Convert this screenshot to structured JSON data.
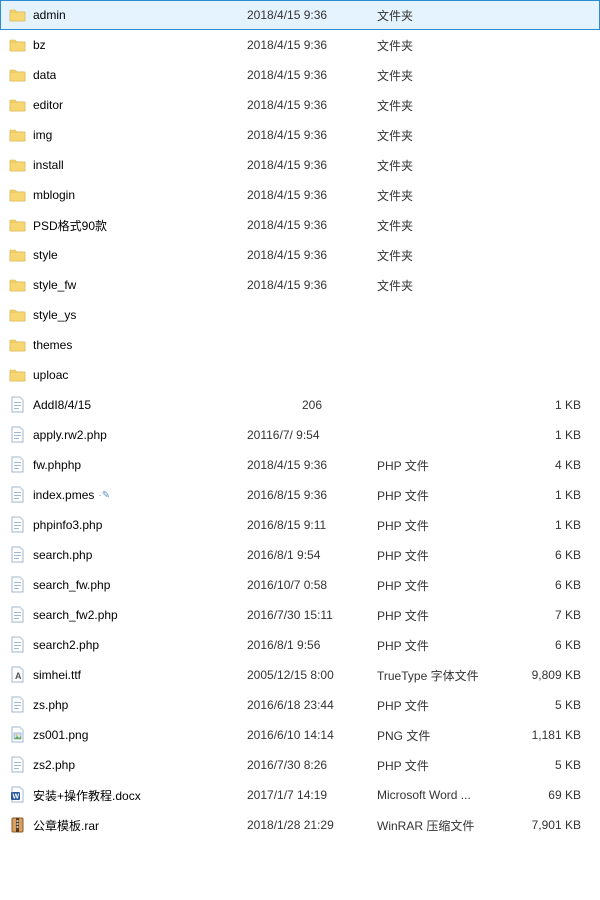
{
  "files": [
    {
      "name": "admin",
      "date": "2018/4/15 9:36",
      "type": "文件夹",
      "size": "",
      "icon": "folder",
      "selected": true
    },
    {
      "name": "bz",
      "date": "2018/4/15 9:36",
      "type": "文件夹",
      "size": "",
      "icon": "folder"
    },
    {
      "name": "data",
      "date": "2018/4/15 9:36",
      "type": "文件夹",
      "size": "",
      "icon": "folder"
    },
    {
      "name": "editor",
      "date": "2018/4/15 9:36",
      "type": "文件夹",
      "size": "",
      "icon": "folder"
    },
    {
      "name": "img",
      "date": "2018/4/15 9:36",
      "type": "文件夹",
      "size": "",
      "icon": "folder"
    },
    {
      "name": "install",
      "date": "2018/4/15 9:36",
      "type": "文件夹",
      "size": "",
      "icon": "folder"
    },
    {
      "name": "mblogin",
      "date": "2018/4/15 9:36",
      "type": "文件夹",
      "size": "",
      "icon": "folder"
    },
    {
      "name": "PSD格式90款",
      "date": "2018/4/15 9:36",
      "type": "文件夹",
      "size": "",
      "icon": "folder"
    },
    {
      "name": "style",
      "date": "2018/4/15 9:36",
      "type": "文件夹",
      "size": "",
      "icon": "folder"
    },
    {
      "name": "style_fw",
      "date": "2018/4/15 9:36",
      "type": "文件夹",
      "size": "",
      "icon": "folder"
    },
    {
      "name": "style_ys",
      "date": "",
      "type": "",
      "size": "",
      "icon": "folder"
    },
    {
      "name": "themes",
      "date": "",
      "type": "",
      "size": "",
      "icon": "folder"
    },
    {
      "name": "uploac",
      "date": "",
      "type": "",
      "size": "",
      "icon": "folder"
    },
    {
      "name": "AddI8/4/15",
      "date": "206",
      "type": "",
      "size": "1 KB",
      "icon": "file",
      "date_align": "center"
    },
    {
      "name": "apply.rw2.php",
      "date": "20116/7/ 9:54",
      "type": "",
      "size": "1 KB",
      "icon": "file"
    },
    {
      "name": "fw.phphp",
      "date": "2018/4/15 9:36",
      "type": "PHP 文件",
      "size": "4 KB",
      "icon": "file"
    },
    {
      "name": "index.pmes",
      "date": "2016/8/15 9:36",
      "type": "PHP 文件",
      "size": "1 KB",
      "icon": "file",
      "editing": true
    },
    {
      "name": "phpinfo3.php",
      "date": "2016/8/15 9:11",
      "type": "PHP 文件",
      "size": "1 KB",
      "icon": "file"
    },
    {
      "name": "search.php",
      "date": "2016/8/1 9:54",
      "type": "PHP 文件",
      "size": "6 KB",
      "icon": "file"
    },
    {
      "name": "search_fw.php",
      "date": "2016/10/7 0:58",
      "type": "PHP 文件",
      "size": "6 KB",
      "icon": "file"
    },
    {
      "name": "search_fw2.php",
      "date": "2016/7/30 15:11",
      "type": "PHP 文件",
      "size": "7 KB",
      "icon": "file"
    },
    {
      "name": "search2.php",
      "date": "2016/8/1 9:56",
      "type": "PHP 文件",
      "size": "6 KB",
      "icon": "file"
    },
    {
      "name": "simhei.ttf",
      "date": "2005/12/15 8:00",
      "type": "TrueType 字体文件",
      "size": "9,809 KB",
      "icon": "font"
    },
    {
      "name": "zs.php",
      "date": "2016/6/18 23:44",
      "type": "PHP 文件",
      "size": "5 KB",
      "icon": "file"
    },
    {
      "name": "zs001.png",
      "date": "2016/6/10 14:14",
      "type": "PNG 文件",
      "size": "1,181 KB",
      "icon": "png"
    },
    {
      "name": "zs2.php",
      "date": "2016/7/30 8:26",
      "type": "PHP 文件",
      "size": "5 KB",
      "icon": "file"
    },
    {
      "name": "安装+操作教程.docx",
      "date": "2017/1/7 14:19",
      "type": "Microsoft Word ...",
      "size": "69 KB",
      "icon": "docx"
    },
    {
      "name": "公章模板.rar",
      "date": "2018/1/28 21:29",
      "type": "WinRAR 压缩文件",
      "size": "7,901 KB",
      "icon": "rar"
    }
  ]
}
